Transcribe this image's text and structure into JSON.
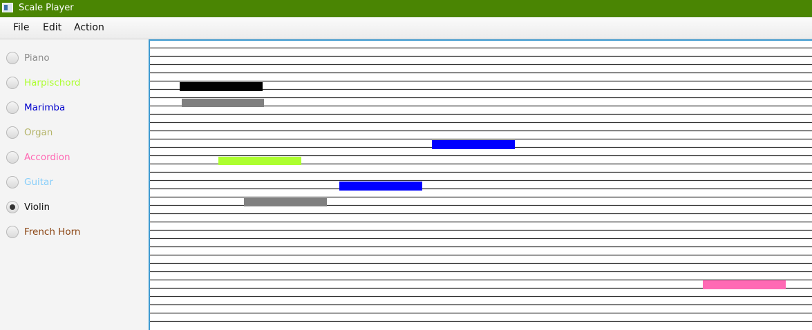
{
  "window": {
    "title": "Scale Player",
    "icon": "app-window-icon"
  },
  "menu": {
    "items": [
      "File",
      "Edit",
      "Action"
    ]
  },
  "instruments": [
    {
      "label": "Piano",
      "color": "#8c8c8c",
      "selected": false
    },
    {
      "label": "Harpischord",
      "color": "#adff2f",
      "selected": false
    },
    {
      "label": "Marimba",
      "color": "#0000cd",
      "selected": false
    },
    {
      "label": "Organ",
      "color": "#b5b56a",
      "selected": false
    },
    {
      "label": "Accordion",
      "color": "#ff69b4",
      "selected": false
    },
    {
      "label": "Guitar",
      "color": "#87cefa",
      "selected": false
    },
    {
      "label": "Violin",
      "color": "#111111",
      "selected": true
    },
    {
      "label": "French Horn",
      "color": "#8b4513",
      "selected": false
    }
  ],
  "composition": {
    "line_color": "#333333",
    "notes": [
      {
        "color": "#000000"
      },
      {
        "color": "#808080"
      },
      {
        "color": "#0000ff"
      },
      {
        "color": "#adff2f"
      },
      {
        "color": "#0000ff"
      },
      {
        "color": "#808080"
      },
      {
        "color": "#ff69b4"
      }
    ]
  }
}
